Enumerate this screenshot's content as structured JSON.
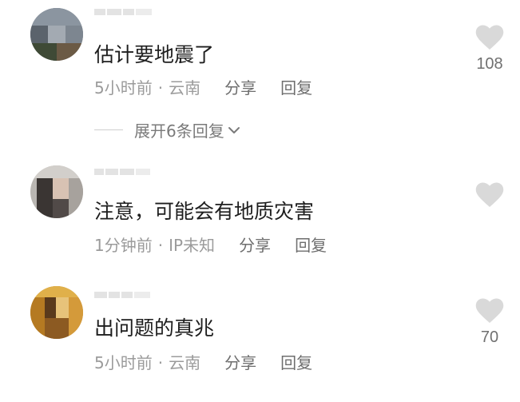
{
  "comments": [
    {
      "text": "估计要地震了",
      "time": "5小时前",
      "separator": "·",
      "location": "云南",
      "share_label": "分享",
      "reply_label": "回复",
      "like_icon": "heart-icon",
      "like_count": "108"
    },
    {
      "text": "注意，可能会有地质灾害",
      "time": "1分钟前",
      "separator": "·",
      "location": "IP未知",
      "share_label": "分享",
      "reply_label": "回复",
      "like_icon": "heart-icon",
      "like_count": ""
    },
    {
      "text": "出问题的真兆",
      "time": "5小时前",
      "separator": "·",
      "location": "云南",
      "share_label": "分享",
      "reply_label": "回复",
      "like_icon": "heart-icon",
      "like_count": "70"
    }
  ],
  "expand_replies": {
    "label": "展开6条回复",
    "icon": "chevron-down-icon"
  },
  "colors": {
    "primary_text": "#1e1e1e",
    "meta_text": "#9b9b9b",
    "action_text": "#6e6e6e",
    "heart": "#d9d9d9"
  }
}
